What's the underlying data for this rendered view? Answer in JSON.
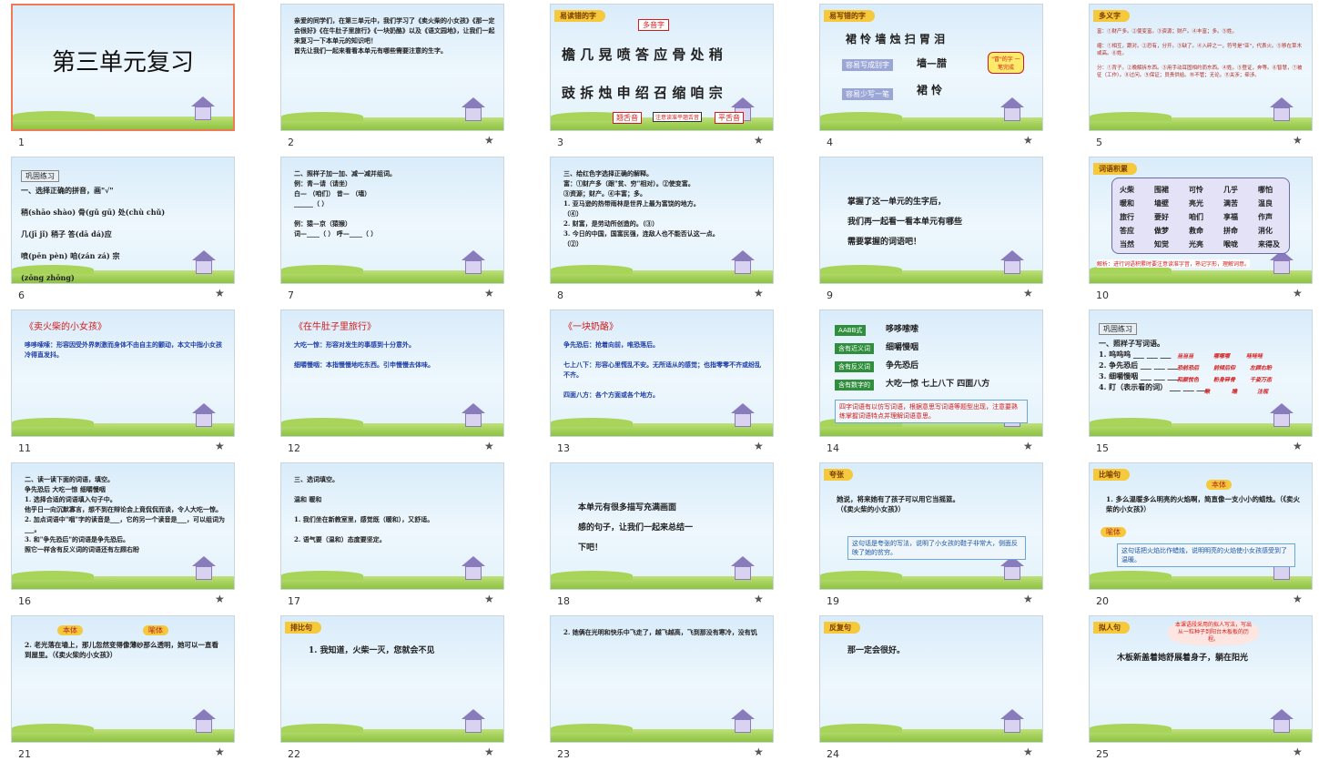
{
  "slides": [
    {
      "num": "1",
      "title": "第三单元复习",
      "selected": true
    },
    {
      "num": "2",
      "text": "    亲爱的同学们，在第三单元中，我们学习了《卖火柴的小女孩》《那一定会很好》《在牛肚子里旅行》《一块奶酪》以及《语文园地》，让我们一起来复习一下本单元的知识吧！\n    首先让我们一起来看看本单元有哪些需要注意的生字。"
    },
    {
      "num": "3",
      "tag": "易读错的字",
      "top_label": "多音字",
      "row1": "檐 几 晃 喷 答 应 骨 处 稍",
      "row2": "豉 拆 烛 申 绍 召 缩 咱 宗",
      "bottom_left": "翘舌音",
      "bottom_mid": "注意读准平翘舌音",
      "bottom_right": "平舌音"
    },
    {
      "num": "4",
      "tag": "易写错的字",
      "row1": "裙 怜 墙 烛 扫 胃 泪",
      "label1": "容易写成别字",
      "value1": "墙—腊",
      "label2": "容易少写一笔",
      "value2": "裙 怜",
      "bubble": "\"冒\"的字 一笔完成"
    },
    {
      "num": "5",
      "tag": "多义字",
      "text": "富：①财产多。②使变富。③资源；财产。④丰富；多。⑤姓。\n\n缩：①相互，跟对。②恐有，分开。③缺了。④入碎之一，符号是\"亚\"，代表火。⑤移在草木或高。⑥姓。\n\n分：①背子。②晚解拆东西。③用手动耳固相约而东西。④姓。⑤登证，奔等。⑥智慧，⑦被征（工作）。⑧过问。⑨保证；员责供给。⑩不管；无论。⑪关涉；牵涉。"
    },
    {
      "num": "6",
      "tagbox": "巩固练习",
      "text": "一、选择正确的拼音，画\"√\"\n\n  稍(shāo shào)  骨(gǔ gū)  处(chù chǔ)\n\n几(jī jǐ)  稍子  答(dā dá)应\n\n喷(pēn pèn)  咱(zán zá)  宗\n\n(zōng zhōng)"
    },
    {
      "num": "7",
      "text": "二、照样子加一加、减一减并组词。\n  例：青—请（请坐）\n  白—    （咱们）  昔—  （墙）\n  ______（    ）\n\n  例：猿—京（猿猴）\n  词—____（  ）   呼—____（  ）"
    },
    {
      "num": "8",
      "text": "三、给红色字选择正确的解释。\n  富：①财产多（跟\"贫、穷\"相对）。②使变富。\n③资源；财产。④丰富；多。\n 1. 亚马逊的热带雨林是世界上最为富饶的地方。\n                                    （④）\n 2. 财富，是劳动所创造的。（③）\n 3. 今日的中国，国富民强，连敌人也不能否认这一点。\n                                    （②）"
    },
    {
      "num": "9",
      "text": "掌握了这一单元的生字后，\n我们再一起看一看本单元有哪些\n需要掌握的词语吧！"
    },
    {
      "num": "10",
      "tag": "词语积累",
      "words": [
        "火柴",
        "围裙",
        "可怜",
        "几乎",
        "哪怕",
        "暖和",
        "墙壁",
        "亮光",
        "满苦",
        "温良",
        "旅行",
        "要好",
        "咱们",
        "享福",
        "作声",
        "答应",
        "做梦",
        "救命",
        "拼命",
        "消化",
        "当然",
        "知觉",
        "光亮",
        "喉咙",
        "来得及"
      ],
      "note": "解析：进行词语积累时要注意读准字音，熟记字形，理解词意。"
    },
    {
      "num": "11",
      "title": "《卖火柴的小女孩》",
      "text": "哆哆嗦嗦：形容因受外界刺激而身体不由自主的颤动，本文中指小女孩冷得直发抖。"
    },
    {
      "num": "12",
      "title": "《在牛肚子里旅行》",
      "text": "大吃一惊：形容对发生的事感到十分意外。\n\n细嚼慢咽：本指慢慢地吃东西。引申慢慢去体味。"
    },
    {
      "num": "13",
      "title": "《一块奶酪》",
      "text": "争先恐后：抢着向前，唯恐落后。\n\n七上八下：形容心里慌乱不安。无所适从的感觉；也指零零不齐或纷乱不齐。\n\n四面八方：各个方面或各个地方。"
    },
    {
      "num": "14",
      "labels": [
        "AABB式",
        "含有近义词",
        "含有反义词",
        "含有数字的"
      ],
      "values": [
        "哆哆嗦嗦",
        "细嚼慢咽",
        "争先恐后",
        "大吃一惊  七上八下  四面八方"
      ],
      "note": "四字词语有以仿写词语，根据意思写词语等题型出现，注意要熟练掌握词语特点并理解词语意思。"
    },
    {
      "num": "15",
      "tagbox": "巩固练习",
      "text": "一、照样子写词语。\n 1. 呜呜呜  ___  ___  ___\n 2. 争先恐后  ___  ___  ___\n 3. 细嚼慢咽  ___  ___  ___\n 4. 盯（表示看的词） ___  ___  ___",
      "answers": [
        "当当当",
        "哪哪哪",
        "哇哇哇",
        "恐前恐后",
        "前倾后仰",
        "左顾右盼",
        "和颜悦色",
        "粉身碎骨",
        "千姿万态",
        "瞅",
        "瞧",
        "注视"
      ]
    },
    {
      "num": "16",
      "text": "二、读一读下面的词语，填空。\n    争先恐后    大吃一惊    细嚼慢咽\n 1. 选择合适的词语填入句子中。\n  他乎日一向沉默寡言，想不到在辩论会上竟侃侃而谈，令人大吃一惊。\n 2. 加点词语中\"咽\"字的读音是___，它的另一个读音是___，可以组词为___。\n 3. 和\"争先恐后\"的词语是争先恐后。\n   照它一样含有反义词的词语还有左顾右盼"
    },
    {
      "num": "17",
      "text": "三、选词填空。\n\n         温和     暖和\n\n 1. 我们坐在新教室里，感觉既（暖和），又舒适。\n\n 2. 语气要（温和）态度要坚定。"
    },
    {
      "num": "18",
      "text": "本单元有很多描写充满画面\n感的句子，让我们一起来总结一\n下吧！"
    },
    {
      "num": "19",
      "tag": "夸张",
      "text": "她说，将来她有了孩子可以用它当摇篮。\n（《卖火柴的小女孩》）",
      "note": "这句话是夸张的写法，说明了小女孩的鞋子非常大，侧面反映了她的贫穷。"
    },
    {
      "num": "20",
      "tag": "比喻句",
      "label1": "本体",
      "text": "1. 多么温暖多么明亮的火焰啊，简直像一支小小的蜡烛。（《卖火柴的小女孩》）",
      "label2": "喻体",
      "note": "这句话把火焰比作蜡烛，说明明亮的火焰使小女孩感受到了温暖。"
    },
    {
      "num": "21",
      "label1": "本体",
      "label2": "喻体",
      "text": "2. 老光落在墙上，那儿忽然变得像薄纱那么透明，她可以一直看到屋里。（《卖火柴的小女孩》）"
    },
    {
      "num": "22",
      "tag": "排比句",
      "text": "1. 我知道，火柴一灭，您就会不见"
    },
    {
      "num": "23",
      "text": "2. 她俩在光明和快乐中飞走了，越飞越高，飞到那没有寒冷，没有饥"
    },
    {
      "num": "24",
      "tag": "反复句",
      "text": "那一定会很好。"
    },
    {
      "num": "25",
      "tag": "拟人句",
      "text": "木板新盖着她舒展着身子，躺在阳光",
      "bubble": "本课语段采用的拟人写法，写出从一粒种子到阳台木板板的历程。"
    }
  ],
  "star": "★"
}
